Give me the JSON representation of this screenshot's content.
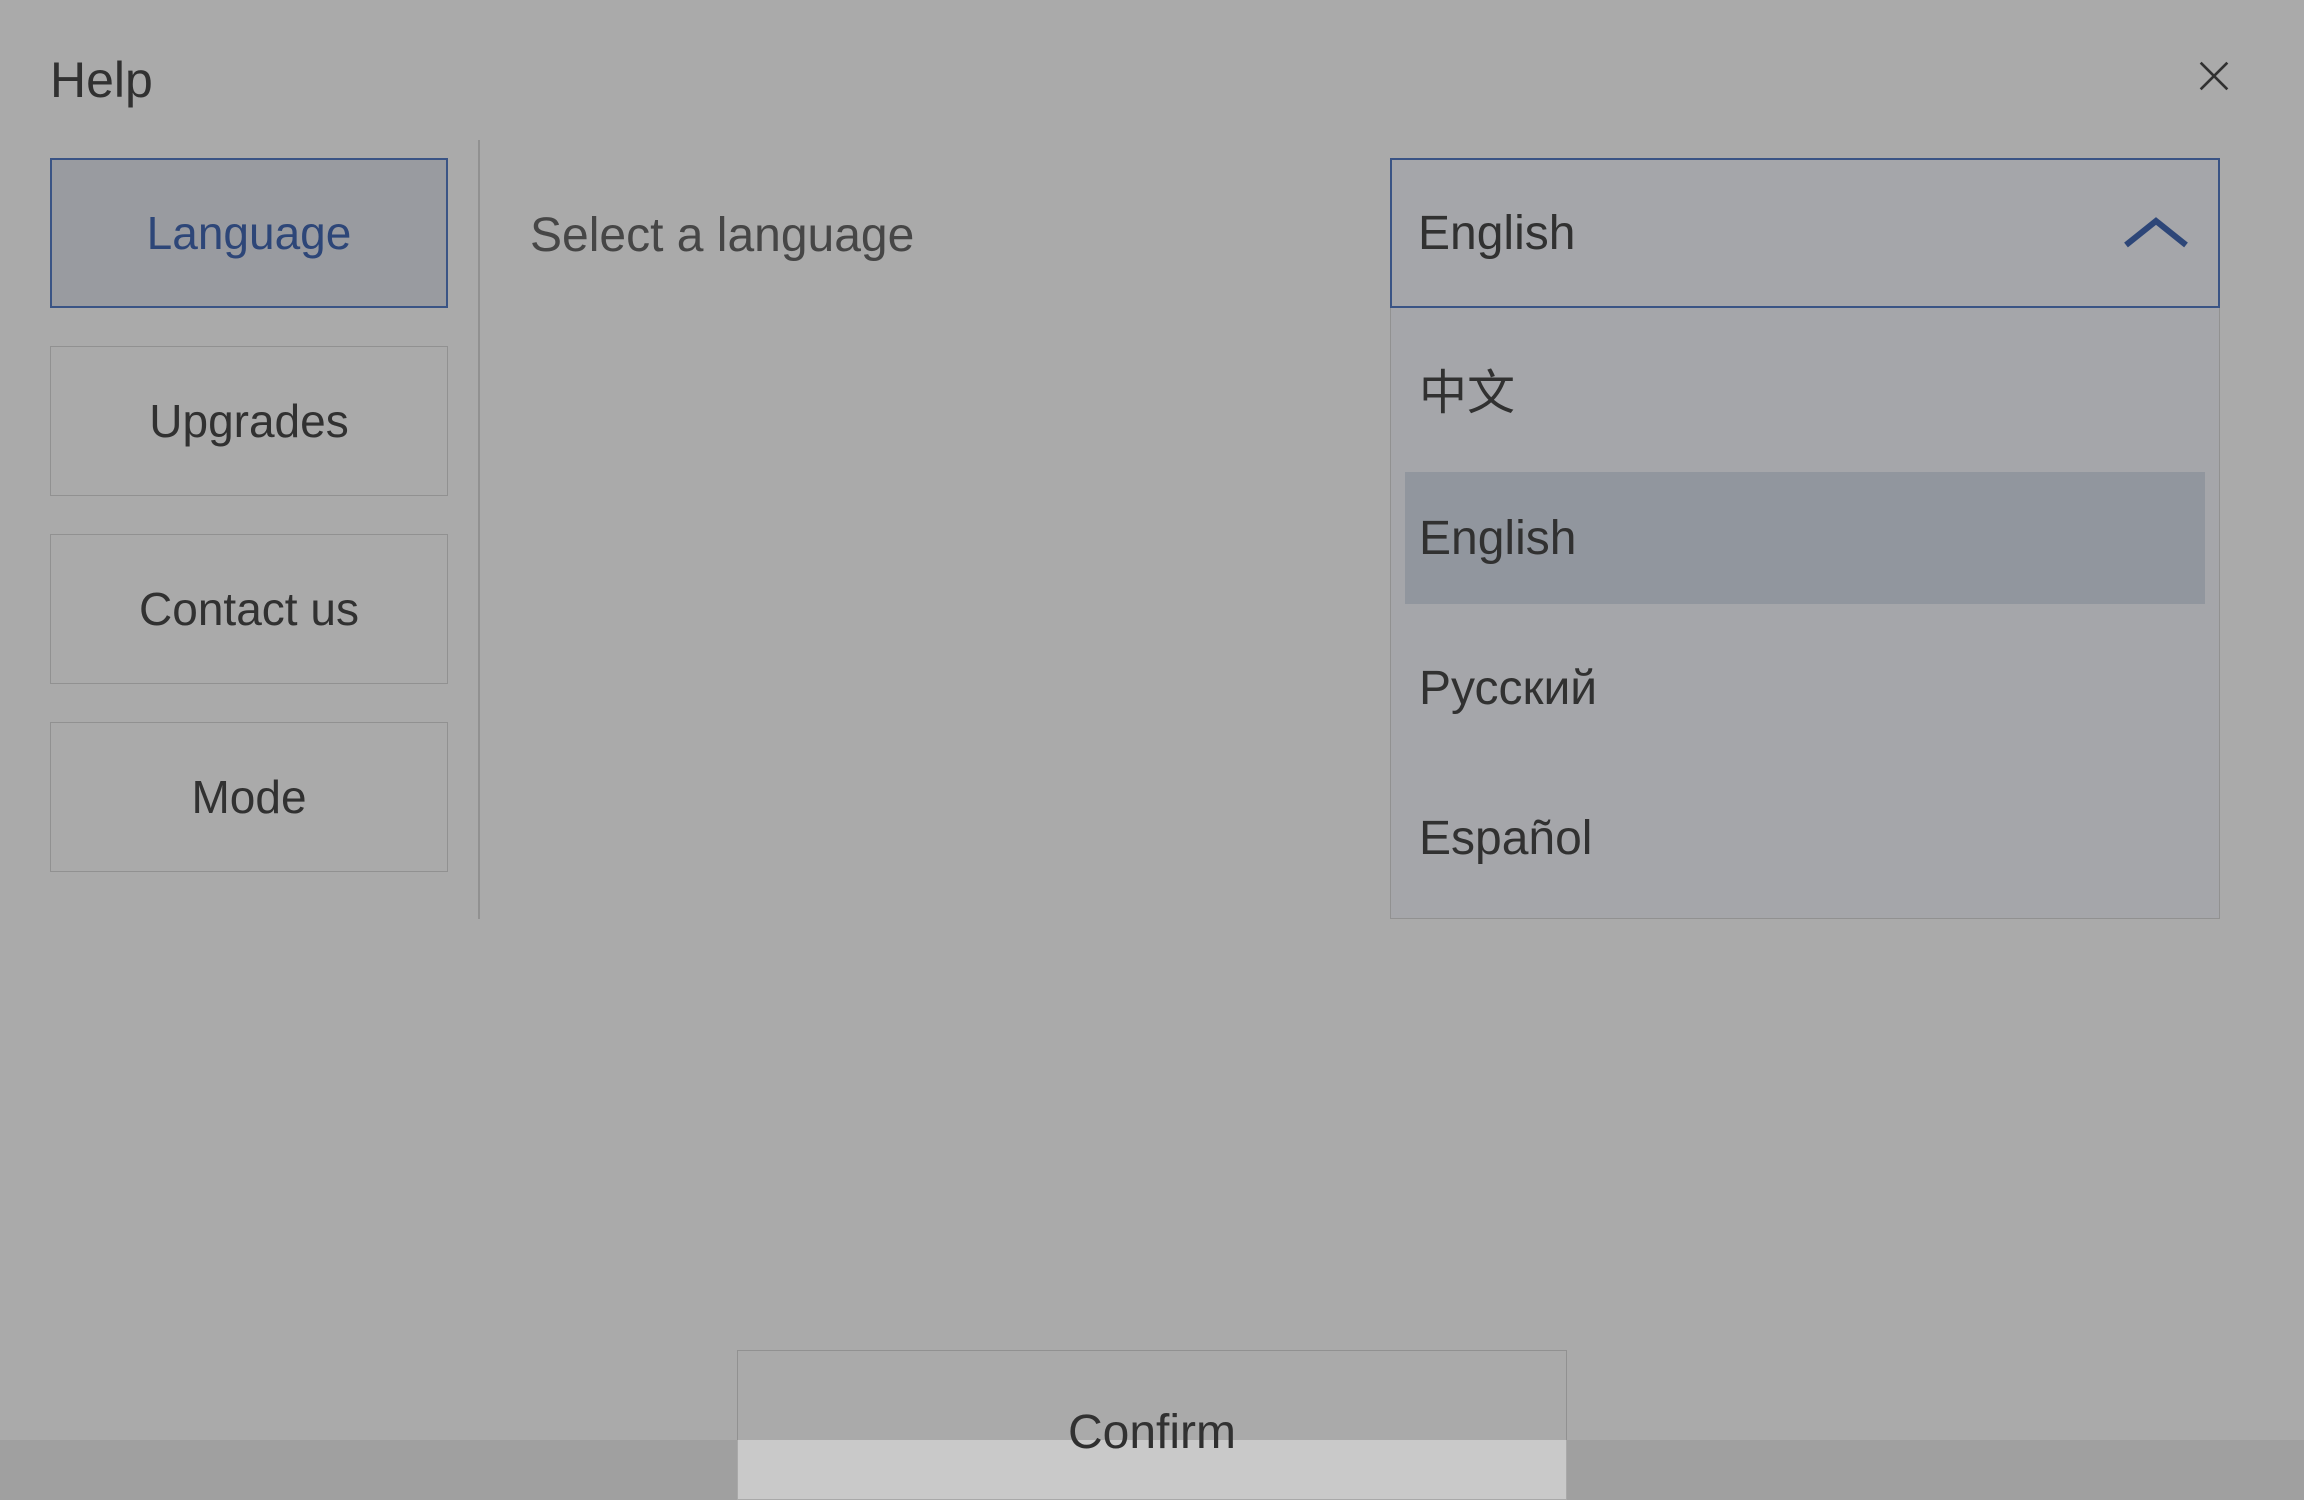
{
  "header": {
    "title": "Help"
  },
  "sidebar": {
    "items": [
      {
        "label": "Language",
        "active": true
      },
      {
        "label": "Upgrades",
        "active": false
      },
      {
        "label": "Contact us",
        "active": false
      },
      {
        "label": "Mode",
        "active": false
      }
    ]
  },
  "content": {
    "label": "Select a language",
    "select": {
      "value": "English",
      "open": true,
      "options": [
        {
          "label": "中文",
          "selected": false
        },
        {
          "label": "English",
          "selected": true
        },
        {
          "label": "Русский",
          "selected": false
        },
        {
          "label": "Español",
          "selected": false
        }
      ]
    },
    "confirm_label": "Confirm"
  },
  "colors": {
    "accent": "#3a5c9a",
    "background": "#c9c9c9",
    "selected_bg": "#aab0ba"
  }
}
